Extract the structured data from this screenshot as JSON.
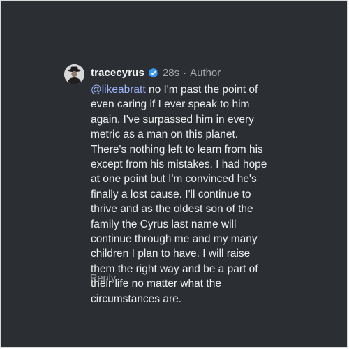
{
  "comment": {
    "username": "tracecyrus",
    "verified_icon": "verified-badge-icon",
    "accent_color": "#3897f0",
    "time": "28s",
    "separator": "·",
    "role": "Author",
    "mention": "@likeabratt",
    "body": " no I'm past the point of even caring if I ever speak to him again. I've surpassed him in every metric as a man on this planet. There's nothing left to learn from his except from his mistakes. I had hope at one point but I'm convinced he's finally a lost cause. I'll continue to thrive and as the oldest son of the family the Cyrus last name will continue through me and my many children I plan to have. I will raise them the right way and be a part of their life no matter what the circumstances are.",
    "reply_label": "Reply"
  }
}
